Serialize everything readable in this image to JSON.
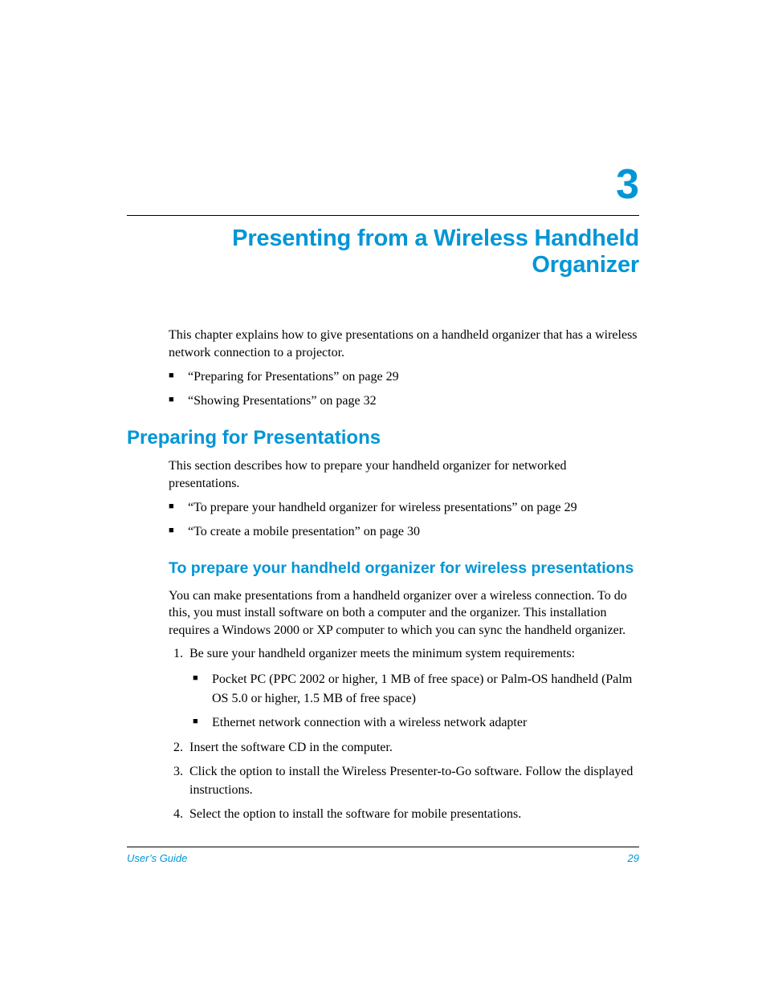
{
  "chapter_number": "3",
  "chapter_title": "Presenting from a Wireless Handheld Organizer",
  "intro_para": "This chapter explains how to give presentations on a handheld organizer that has a wireless network connection to a projector.",
  "chapter_links": [
    "“Preparing for Presentations” on page 29",
    "“Showing Presentations” on page 32"
  ],
  "section1": {
    "title": "Preparing for Presentations",
    "intro": "This section describes how to prepare your handheld organizer for networked presentations.",
    "links": [
      "“To prepare your handheld organizer for wireless presentations” on page 29",
      "“To create a mobile presentation” on page 30"
    ],
    "sub": {
      "title": "To prepare your handheld organizer for wireless presentations",
      "para": "You can make presentations from a handheld organizer over a wireless connection. To do this, you must install software on both a computer and the organizer. This installation requires a Windows 2000 or XP computer to which you can sync the handheld organizer.",
      "steps": {
        "s1": "Be sure your handheld organizer meets the minimum system requirements:",
        "s1_bullets": [
          "Pocket PC (PPC 2002 or higher, 1 MB of free space) or Palm-OS handheld (Palm OS 5.0 or higher, 1.5 MB of free space)",
          "Ethernet network connection with a wireless network adapter"
        ],
        "s2": "Insert the software CD in the computer.",
        "s3": "Click the option to install the Wireless Presenter-to-Go software. Follow the displayed instructions.",
        "s4": "Select the option to install the software for mobile presentations."
      }
    }
  },
  "footer": {
    "left": "User’s Guide",
    "right": "29"
  }
}
